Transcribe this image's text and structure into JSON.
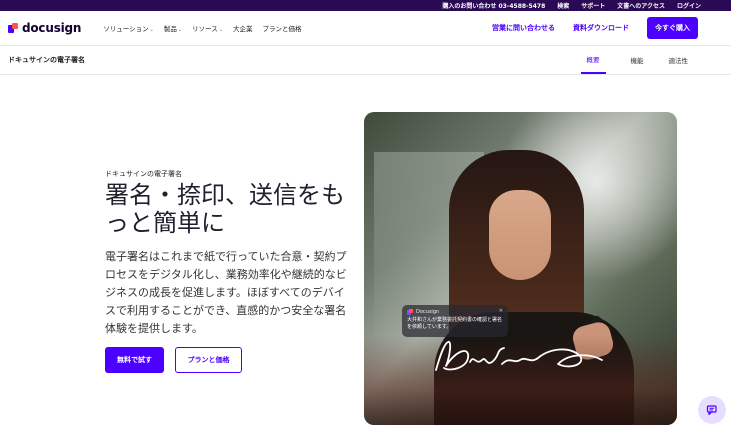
{
  "utility_bar": {
    "items": [
      "購入のお問い合わせ 03-4588-5478",
      "検索",
      "サポート",
      "文書へのアクセス",
      "ログイン"
    ]
  },
  "nav": {
    "logo_text": "docusign",
    "menu": [
      {
        "label": "ソリューション",
        "has_dropdown": true
      },
      {
        "label": "製品",
        "has_dropdown": true
      },
      {
        "label": "リソース",
        "has_dropdown": true
      },
      {
        "label": "大企業",
        "has_dropdown": false
      },
      {
        "label": "プランと価格",
        "has_dropdown": false
      }
    ],
    "contact_sales": "営業に問い合わせる",
    "download": "資料ダウンロード",
    "buy_now": "今すぐ購入"
  },
  "subnav": {
    "title": "ドキュサインの電子署名",
    "tabs": [
      {
        "label": "概要",
        "active": true
      },
      {
        "label": "機能",
        "active": false
      },
      {
        "label": "適法性",
        "active": false
      }
    ]
  },
  "hero": {
    "eyebrow": "ドキュサインの電子署名",
    "headline": "署名・捺印、送信をもっと簡単に",
    "description": "電子署名はこれまで紙で行っていた合意・契約プロセスをデジタル化し、業務効率化や継続的なビジネスの成長を促進します。ほぼすべてのデバイスで利用することができ、直感的かつ安全な署名体験を提供します。",
    "primary_cta": "無料で試す",
    "secondary_cta": "プランと価格"
  },
  "notification": {
    "app": "Docusign",
    "message": "大井和さんが業務委託契約書の確認と署名を依頼しています。"
  },
  "colors": {
    "brand": "#4c00ff",
    "utility_bar": "#2a0a55",
    "chat_bubble": "#e6ddff"
  }
}
